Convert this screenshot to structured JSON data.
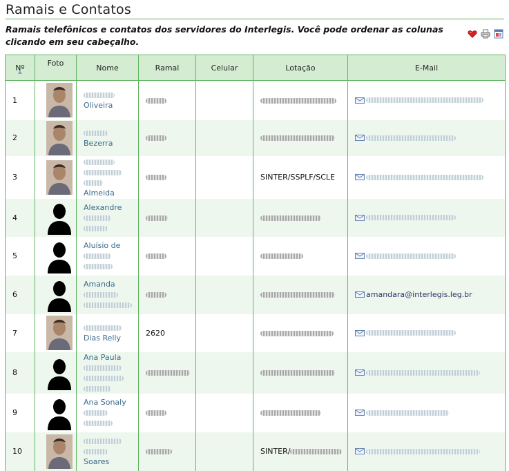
{
  "page": {
    "title": "Ramais e Contatos",
    "description": "Ramais telefônicos e contatos dos servidores do Interlegis. Você pode ordenar as colunas clicando em seu cabeçalho."
  },
  "actions": [
    {
      "name": "favorite-icon"
    },
    {
      "name": "print-icon"
    },
    {
      "name": "fullscreen-icon"
    }
  ],
  "colors": {
    "header_bg": "#d4ecd2",
    "border": "#5fb35f",
    "row_alt": "#eef7ee",
    "link": "#3a6a8a"
  },
  "table": {
    "columns": [
      "Nº",
      "Foto",
      "Nome",
      "Ramal",
      "Celular",
      "Lotação",
      "E-Mail"
    ],
    "rows": [
      {
        "num": "1",
        "photo": "photo-person",
        "name_lines": [
          {
            "text": "",
            "blur": 45
          },
          {
            "text": "Oliveira"
          }
        ],
        "ramal": {
          "blur": 30
        },
        "celular": "",
        "lotacao": {
          "blur": 110
        },
        "email": {
          "text": "",
          "blur": 170
        }
      },
      {
        "num": "2",
        "photo": "photo-person",
        "name_lines": [
          {
            "text": "",
            "blur": 35
          },
          {
            "text": "Bezerra"
          }
        ],
        "ramal": {
          "blur": 30
        },
        "celular": "",
        "lotacao": {
          "blur": 108
        },
        "email": {
          "text": "",
          "blur": 130
        }
      },
      {
        "num": "3",
        "photo": "photo-person",
        "name_lines": [
          {
            "text": "",
            "blur": 45
          },
          {
            "text": "",
            "blur": 55
          },
          {
            "text": "",
            "blur": 28
          },
          {
            "text": "Almeida"
          }
        ],
        "ramal": {
          "blur": 30
        },
        "celular": "",
        "lotacao": {
          "text": "SINTER/SSPLF/SCLE"
        },
        "email": {
          "text": "",
          "blur": 170
        }
      },
      {
        "num": "4",
        "photo": "photo-silhouette",
        "name_lines": [
          {
            "text": "Alexandre"
          },
          {
            "text": "",
            "blur": 40
          },
          {
            "text": "",
            "blur": 35
          }
        ],
        "ramal": {
          "blur": 32
        },
        "celular": "",
        "lotacao": {
          "blur": 88
        },
        "email": {
          "text": "",
          "blur": 130
        }
      },
      {
        "num": "5",
        "photo": "photo-silhouette",
        "name_lines": [
          {
            "text": "Aluísio de"
          },
          {
            "text": "",
            "blur": 40
          },
          {
            "text": "",
            "blur": 42
          }
        ],
        "ramal": {
          "blur": 30
        },
        "celular": "",
        "lotacao": {
          "blur": 62
        },
        "email": {
          "text": "",
          "blur": 130
        }
      },
      {
        "num": "6",
        "photo": "photo-silhouette",
        "name_lines": [
          {
            "text": "Amanda"
          },
          {
            "text": "",
            "blur": 50
          },
          {
            "text": "",
            "blur": 70
          }
        ],
        "ramal": {
          "blur": 30
        },
        "celular": "",
        "lotacao": {
          "blur": 108
        },
        "email": {
          "text": "amandara@interlegis.leg.br"
        }
      },
      {
        "num": "7",
        "photo": "photo-person",
        "name_lines": [
          {
            "text": "",
            "blur": 55
          },
          {
            "text": "Dias Relly"
          }
        ],
        "ramal": {
          "text": "2620"
        },
        "celular": "",
        "lotacao": {
          "blur": 106
        },
        "email": {
          "text": "",
          "blur": 130
        }
      },
      {
        "num": "8",
        "photo": "photo-silhouette",
        "name_lines": [
          {
            "text": "Ana Paula"
          },
          {
            "text": "",
            "blur": 55
          },
          {
            "text": "",
            "blur": 58
          },
          {
            "text": "",
            "blur": 40
          }
        ],
        "ramal": {
          "blur": 64
        },
        "celular": "",
        "lotacao": {
          "blur": 108
        },
        "email": {
          "text": "",
          "blur": 165
        }
      },
      {
        "num": "9",
        "photo": "photo-silhouette",
        "name_lines": [
          {
            "text": "Ana Sonaly"
          },
          {
            "text": "",
            "blur": 35
          },
          {
            "text": "",
            "blur": 42
          }
        ],
        "ramal": {
          "blur": 30
        },
        "celular": "",
        "lotacao": {
          "blur": 88
        },
        "email": {
          "text": "",
          "blur": 120
        }
      },
      {
        "num": "10",
        "photo": "photo-person",
        "name_lines": [
          {
            "text": "",
            "blur": 55
          },
          {
            "text": "",
            "blur": 35
          },
          {
            "text": "Soares"
          }
        ],
        "ramal": {
          "blur": 38
        },
        "celular": "",
        "lotacao": {
          "text": "SINTER/",
          "blur": 75
        },
        "email": {
          "text": "",
          "blur": 165
        }
      }
    ]
  }
}
